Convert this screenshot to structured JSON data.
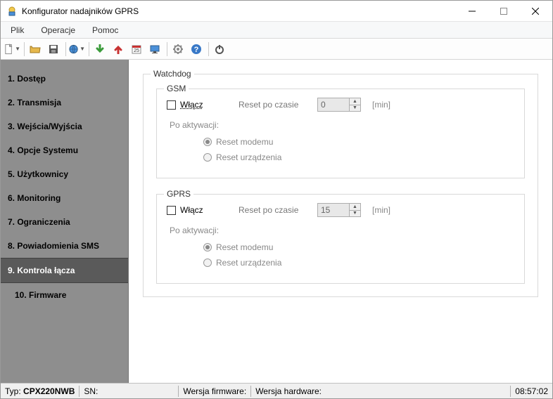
{
  "window": {
    "title": "Konfigurator nadajników GPRS"
  },
  "menubar": [
    "Plik",
    "Operacje",
    "Pomoc"
  ],
  "sidebar": {
    "items": [
      {
        "label": "1. Dostęp",
        "active": false
      },
      {
        "label": "2. Transmisja",
        "active": false
      },
      {
        "label": "3. Wejścia/Wyjścia",
        "active": false
      },
      {
        "label": "4. Opcje Systemu",
        "active": false
      },
      {
        "label": "5. Użytkownicy",
        "active": false
      },
      {
        "label": "6. Monitoring",
        "active": false
      },
      {
        "label": "7. Ograniczenia",
        "active": false
      },
      {
        "label": "8. Powiadomienia SMS",
        "active": false
      },
      {
        "label": "9. Kontrola łącza",
        "active": true
      },
      {
        "label": "10. Firmware",
        "active": false,
        "child": true
      }
    ]
  },
  "content": {
    "watchdog_legend": "Watchdog",
    "gsm": {
      "legend": "GSM",
      "enable_label": "Włącz",
      "reset_after_label": "Reset po czasie",
      "reset_value": "0",
      "unit": "[min]",
      "after_activation": "Po aktywacji:",
      "radio_modem": "Reset modemu",
      "radio_device": "Reset urządzenia"
    },
    "gprs": {
      "legend": "GPRS",
      "enable_label": "Włącz",
      "reset_after_label": "Reset po czasie",
      "reset_value": "15",
      "unit": "[min]",
      "after_activation": "Po aktywacji:",
      "radio_modem": "Reset modemu",
      "radio_device": "Reset urządzenia"
    }
  },
  "statusbar": {
    "typ_label": "Typ:",
    "typ_value": "CPX220NWB",
    "sn_label": "SN:",
    "sn_value": "",
    "fw_label": "Wersja firmware:",
    "fw_value": "",
    "hw_label": "Wersja hardware:",
    "hw_value": "",
    "time": "08:57:02"
  }
}
